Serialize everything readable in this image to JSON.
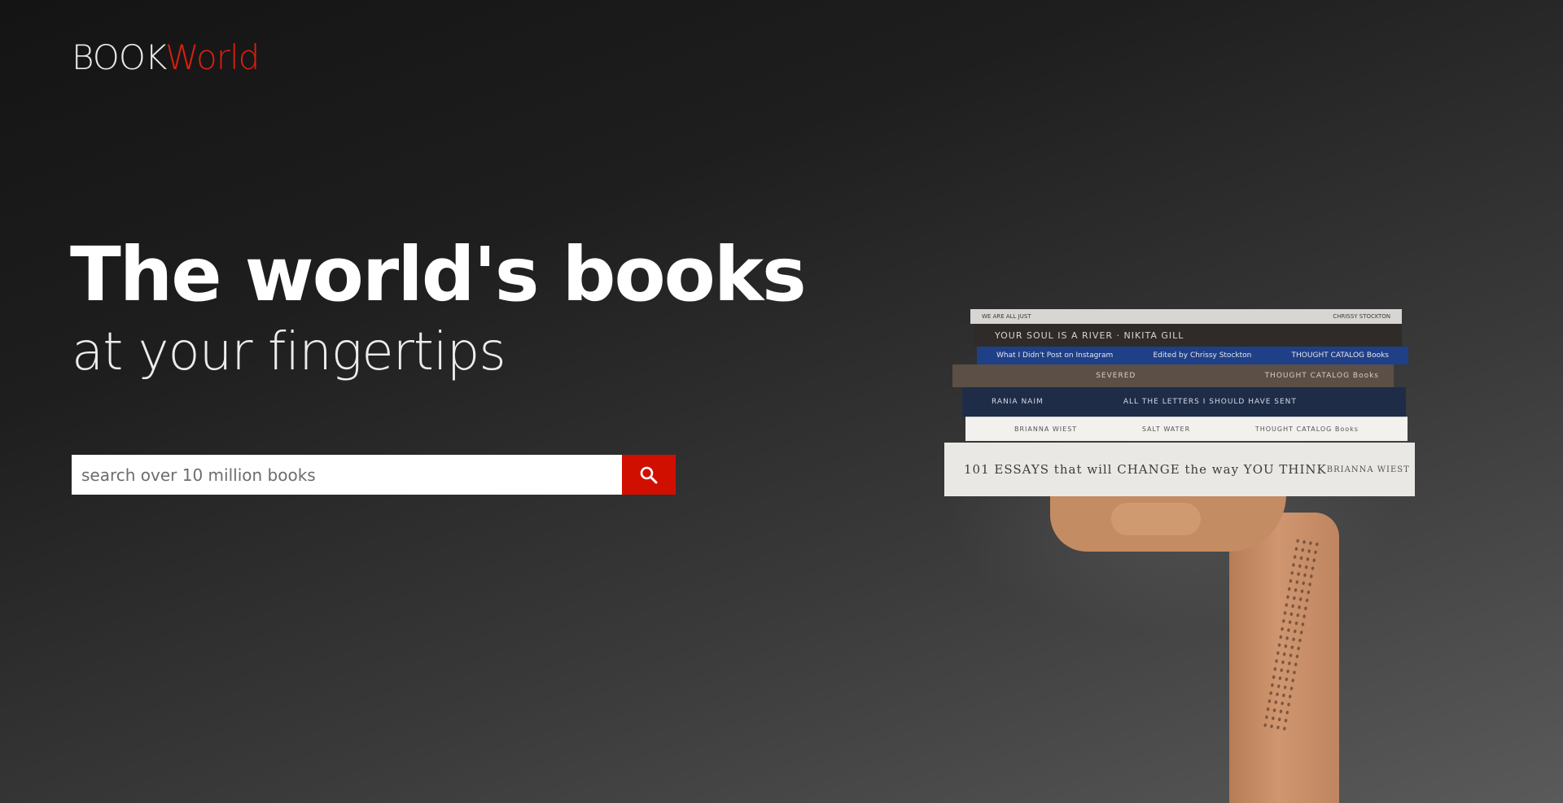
{
  "logo": {
    "part1": "BOOK",
    "part2": "World"
  },
  "hero": {
    "title": "The world's books",
    "subtitle": "at your fingertips"
  },
  "search": {
    "placeholder": "search over 10 million books",
    "value": "",
    "button_icon": "search-icon"
  },
  "illustration": {
    "books": [
      {
        "left": "WE ARE ALL JUST",
        "right": "CHRISSY STOCKTON"
      },
      {
        "left": "YOUR SOUL IS A RIVER  ·  NIKITA GILL",
        "right": ""
      },
      {
        "left": "What I Didn't Post on Instagram",
        "middle": "Edited by Chrissy Stockton",
        "right": "THOUGHT CATALOG Books"
      },
      {
        "left": "",
        "middle": "SEVERED",
        "right": "THOUGHT CATALOG Books"
      },
      {
        "left": "RANIA NAIM",
        "middle": "ALL THE LETTERS I SHOULD HAVE SENT",
        "right": ""
      },
      {
        "left": "BRIANNA WIEST",
        "middle": "SALT WATER",
        "right": "THOUGHT CATALOG Books"
      },
      {
        "left": "101 ESSAYS that will CHANGE the way YOU THINK",
        "right": "BRIANNA WIEST"
      }
    ]
  },
  "colors": {
    "accent": "#d10f00",
    "logo_accent": "#d8200f",
    "text": "#ffffff"
  }
}
